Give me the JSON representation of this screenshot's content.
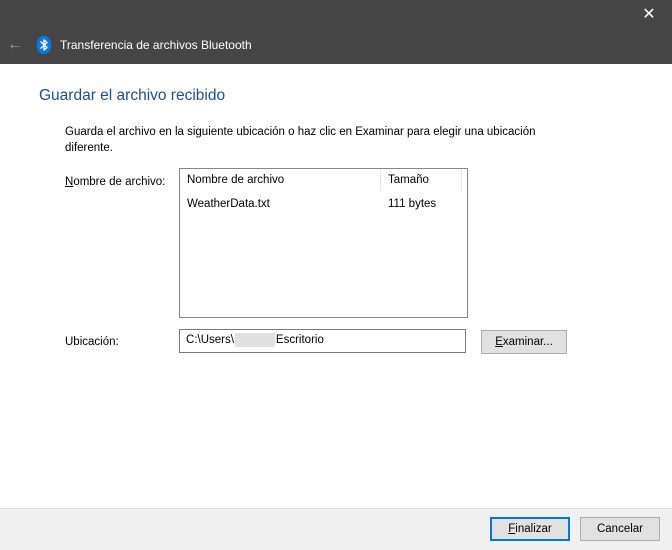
{
  "window": {
    "title": "Transferencia de archivos Bluetooth",
    "close_glyph": "✕",
    "back_glyph": "←"
  },
  "page": {
    "heading": "Guardar el archivo recibido",
    "instructions": "Guarda el archivo en la siguiente ubicación o haz clic en Examinar para elegir una ubicación diferente."
  },
  "filename_section": {
    "label_accel": "N",
    "label_rest": "ombre de archivo:",
    "columns": [
      "Nombre de archivo",
      "Tamaño"
    ],
    "rows": [
      {
        "name": "WeatherData.txt",
        "size": "111 bytes"
      }
    ]
  },
  "location_section": {
    "label": "Ubicación:",
    "path_prefix": "C:\\Users\\",
    "path_suffix": "Escritorio",
    "browse_accel": "E",
    "browse_rest": "xaminar..."
  },
  "footer": {
    "finish_accel": "F",
    "finish_rest": "inalizar",
    "cancel_label": "Cancelar"
  },
  "colors": {
    "titlebar": "#464646",
    "heading": "#1c4ea0",
    "bluetooth": "#0a7ae2",
    "focus": "#0078d7"
  }
}
